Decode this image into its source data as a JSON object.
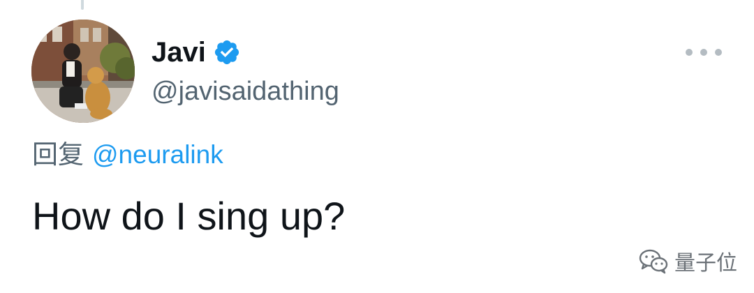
{
  "tweet": {
    "author": {
      "display_name": "Javi",
      "handle": "@javisaidathing",
      "verified": true,
      "avatar_icon": "user-photo-avatar"
    },
    "reply_prefix": "回复",
    "reply_to": "@neuralink",
    "text": "How do I sing up?",
    "more_icon": "more-horizontal-icon"
  },
  "watermark": {
    "icon": "wechat-icon",
    "text": "量子位"
  },
  "colors": {
    "verified_blue": "#1d9bf0",
    "mention_blue": "#1d9bf0",
    "primary_text": "#0f1419",
    "secondary_text": "#536471"
  }
}
